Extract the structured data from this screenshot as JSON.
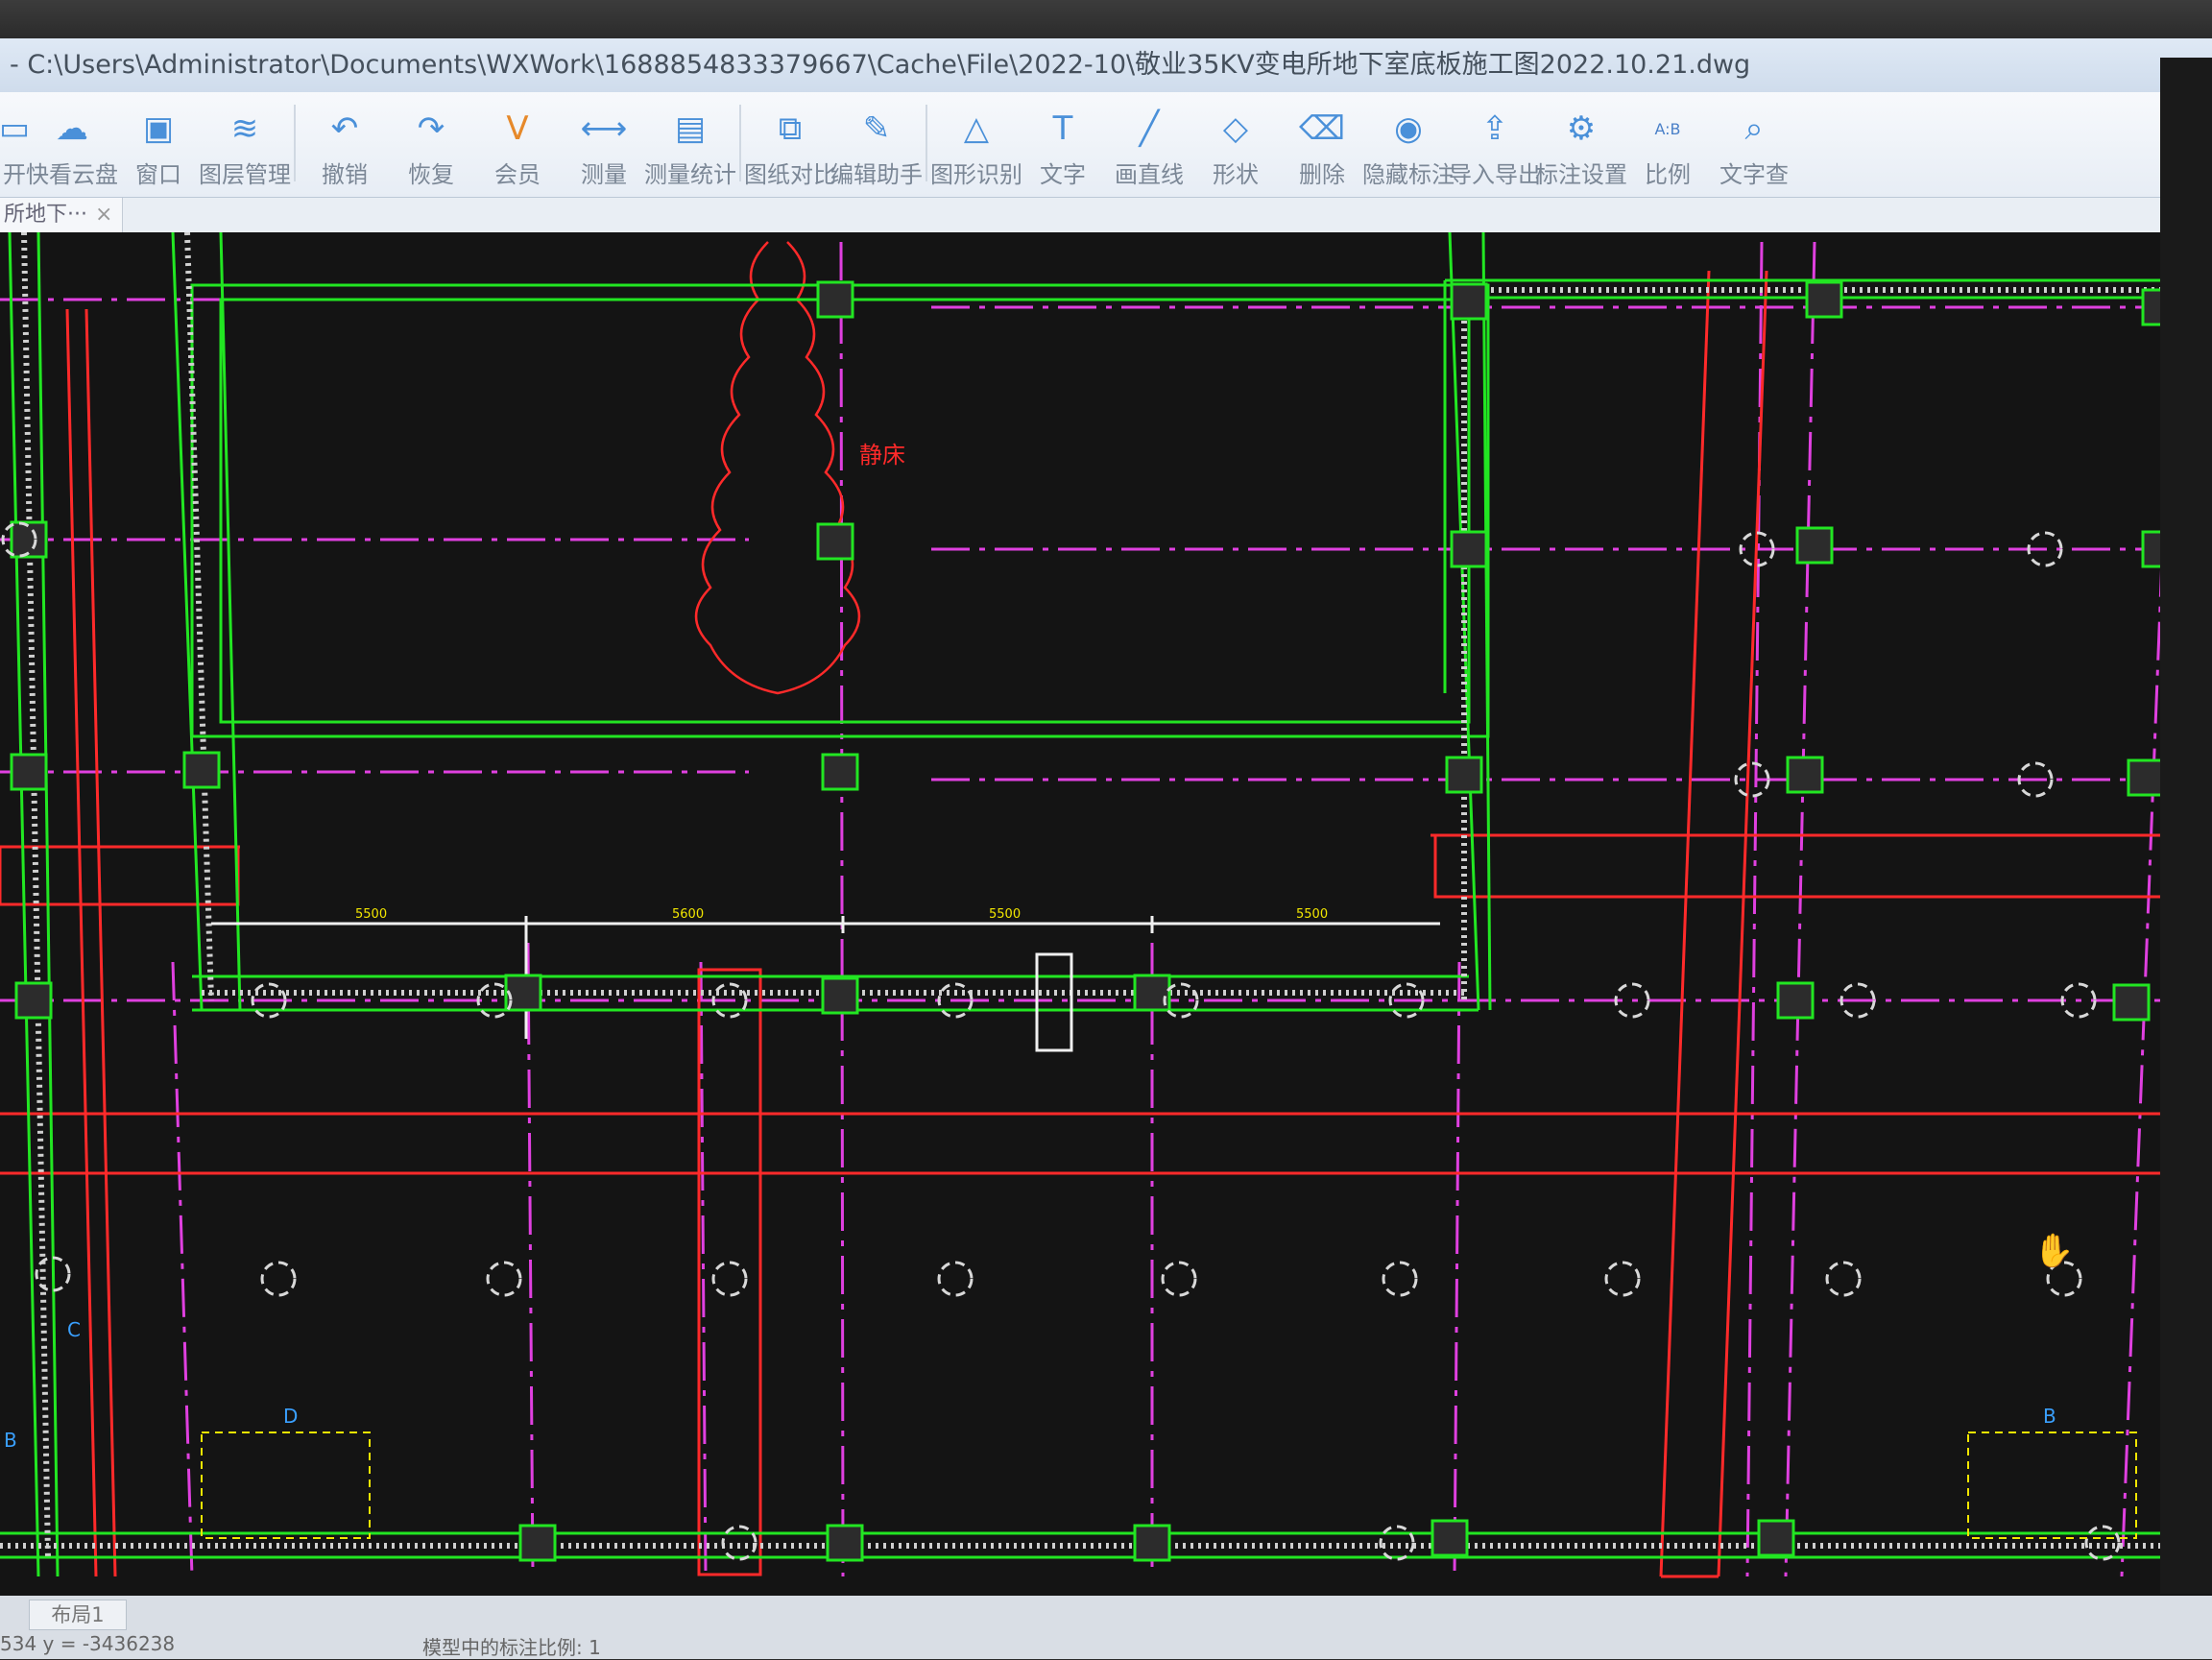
{
  "window": {
    "title": "- C:\\Users\\Administrator\\Documents\\WXWork\\1688854833379667\\Cache\\File\\2022-10\\敬业35KV变电所地下室底板施工图2022.10.21.dwg"
  },
  "toolbar": {
    "items": [
      {
        "label": "开",
        "icon": "open-icon"
      },
      {
        "label": "快看云盘",
        "icon": "cloud-icon"
      },
      {
        "label": "窗口",
        "icon": "window-icon"
      },
      {
        "label": "图层管理",
        "icon": "layers-icon"
      },
      {
        "label": "撤销",
        "icon": "undo-icon"
      },
      {
        "label": "恢复",
        "icon": "redo-icon"
      },
      {
        "label": "会员",
        "icon": "vip-icon"
      },
      {
        "label": "测量",
        "icon": "ruler-icon"
      },
      {
        "label": "测量统计",
        "icon": "measure-stats-icon"
      },
      {
        "label": "图纸对比",
        "icon": "compare-icon"
      },
      {
        "label": "编辑助手",
        "icon": "cad-edit-icon"
      },
      {
        "label": "图形识别",
        "icon": "shape-recognize-icon"
      },
      {
        "label": "文字",
        "icon": "text-icon"
      },
      {
        "label": "画直线",
        "icon": "line-icon"
      },
      {
        "label": "形状",
        "icon": "shape-icon"
      },
      {
        "label": "删除",
        "icon": "eraser-icon"
      },
      {
        "label": "隐藏标注",
        "icon": "hide-icon"
      },
      {
        "label": "导入导出",
        "icon": "import-export-icon"
      },
      {
        "label": "标注设置",
        "icon": "annotation-settings-icon"
      },
      {
        "label": "比例",
        "icon": "scale-icon"
      },
      {
        "label": "文字查",
        "icon": "text-search-icon"
      }
    ],
    "ratio_glyph": "A:B"
  },
  "tabs": {
    "doc_tab_label": "所地下···",
    "close_glyph": "×"
  },
  "drawing": {
    "label_cloud": "静床",
    "dim_labels": [
      "5500",
      "5600",
      "5500",
      "5500"
    ],
    "axis_letters": [
      "C",
      "D",
      "B",
      "B"
    ]
  },
  "status": {
    "layout_tab": "布局1",
    "coords": "534  y = -3436238",
    "scale_text": "模型中的标注比例: 1"
  },
  "colors": {
    "canvas_bg": "#141414",
    "beam_red": "#ff2a2a",
    "wall_green": "#22e622",
    "axis_magenta": "#e040e0",
    "text_yellow": "#f2e600",
    "dim_white": "#f0f0f0"
  }
}
